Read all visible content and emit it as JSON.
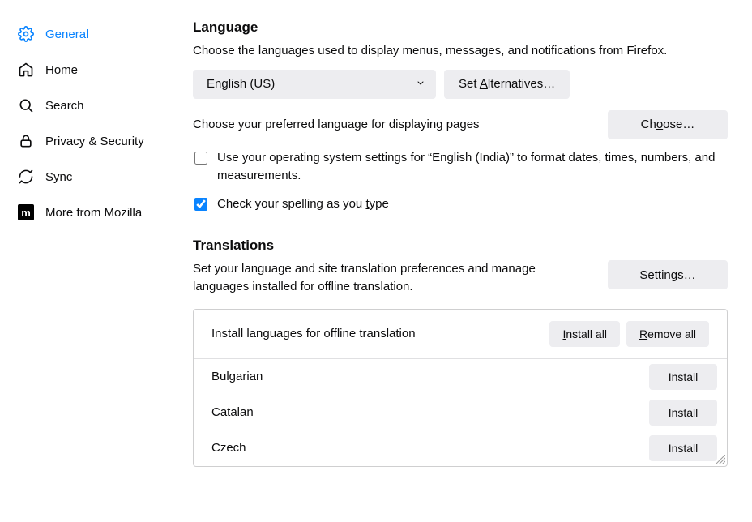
{
  "sidebar": {
    "items": [
      {
        "label": "General",
        "active": true
      },
      {
        "label": "Home",
        "active": false
      },
      {
        "label": "Search",
        "active": false
      },
      {
        "label": "Privacy & Security",
        "active": false
      },
      {
        "label": "Sync",
        "active": false
      },
      {
        "label": "More from Mozilla",
        "active": false
      }
    ]
  },
  "language": {
    "title": "Language",
    "desc": "Choose the languages used to display menus, messages, and notifications from Firefox.",
    "selected": "English (US)",
    "set_alternatives": "Set Alternatives…",
    "choose_desc": "Choose your preferred language for displaying pages",
    "choose_btn": "Choose…",
    "os_setting_label": "Use your operating system settings for “English (India)” to format dates, times, numbers, and measurements.",
    "os_setting_checked": false,
    "spellcheck_label": "Check your spelling as you type",
    "spellcheck_checked": true
  },
  "translations": {
    "title": "Translations",
    "desc": "Set your language and site translation preferences and manage languages installed for offline translation.",
    "settings_btn": "Settings…",
    "install_header": "Install languages for offline translation",
    "install_all": "Install all",
    "remove_all": "Remove all",
    "install_btn": "Install",
    "languages": [
      {
        "name": "Bulgarian"
      },
      {
        "name": "Catalan"
      },
      {
        "name": "Czech"
      }
    ]
  }
}
